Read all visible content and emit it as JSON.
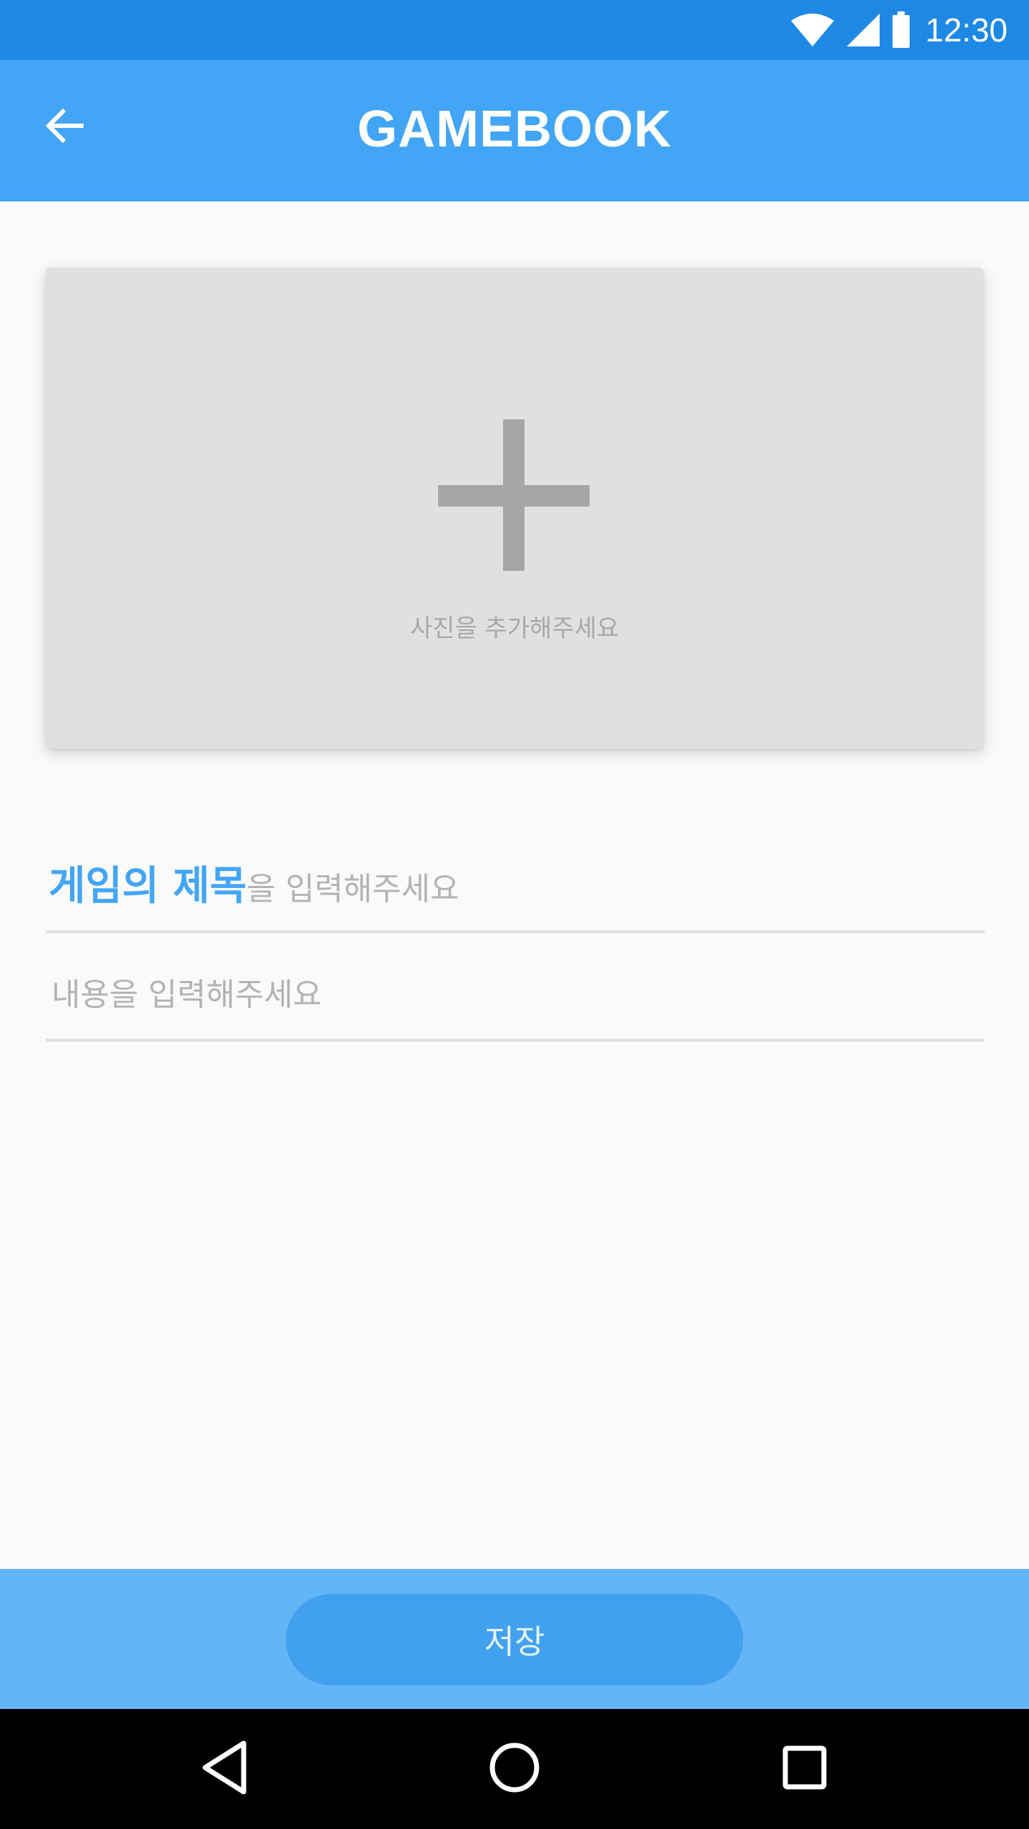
{
  "status_bar": {
    "time": "12:30",
    "icons": [
      "wifi-icon",
      "signal-icon",
      "battery-icon"
    ]
  },
  "app_bar": {
    "title": "GAMEBOOK",
    "back_icon": "arrow-left-icon",
    "background": "#42a5f5"
  },
  "photo_picker": {
    "icon": "plus-icon",
    "label": "사진을 추가해주세요"
  },
  "title_field": {
    "hint_emphasis": "게임의 제목",
    "hint_rest": "을 입력해주세요",
    "value": ""
  },
  "content_field": {
    "placeholder": "내용을 입력해주세요",
    "value": ""
  },
  "bottom_bar": {
    "save_label": "저장",
    "background": "#64b5f6"
  },
  "nav_bar": {
    "icons": [
      "back-triangle-icon",
      "home-circle-icon",
      "recents-square-icon"
    ]
  },
  "colors": {
    "status_bar": "#1e88e5",
    "accent": "#42a5f5"
  }
}
